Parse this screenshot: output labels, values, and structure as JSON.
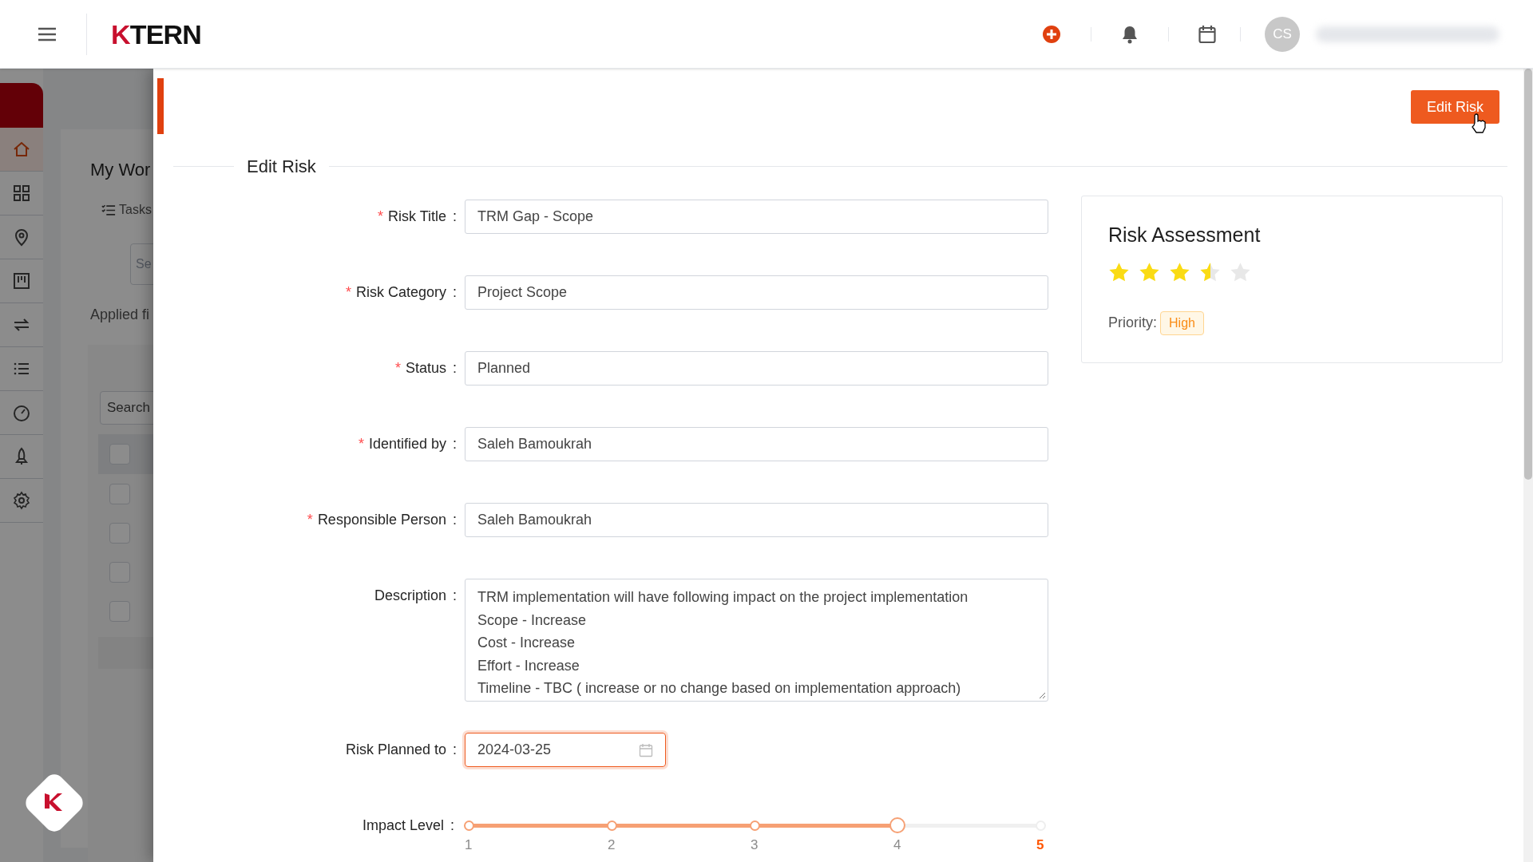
{
  "header": {
    "logo": "KTERN",
    "avatar_initials": "CS"
  },
  "sidebar": {
    "items": [
      {
        "selected": true
      },
      {
        "selected": false
      },
      {
        "selected": false
      },
      {
        "selected": false
      },
      {
        "selected": false
      },
      {
        "selected": false
      },
      {
        "selected": false
      },
      {
        "selected": false
      },
      {
        "selected": false
      }
    ]
  },
  "background_page": {
    "title": "My Wor",
    "tab": "Tasks",
    "search_placeholder": "Se",
    "applied_filters": "Applied fi",
    "table_search_placeholder": "Search",
    "rows": [
      {
        "kind": "header",
        "checked": false
      },
      {
        "kind": "row",
        "checked": false
      },
      {
        "kind": "row",
        "checked": false
      },
      {
        "kind": "row",
        "checked": false
      },
      {
        "kind": "row",
        "checked": false
      }
    ]
  },
  "drawer": {
    "action_button": "Edit Risk",
    "section_title": "Edit Risk",
    "fields": [
      {
        "kind": "input",
        "required_mark": "*",
        "label": "Risk Title",
        "separator": ":",
        "value": "TRM Gap - Scope"
      },
      {
        "kind": "input",
        "required_mark": "*",
        "label": "Risk Category",
        "separator": ":",
        "value": "Project Scope"
      },
      {
        "kind": "input",
        "required_mark": "*",
        "label": "Status",
        "separator": ":",
        "value": "Planned"
      },
      {
        "kind": "input",
        "required_mark": "*",
        "label": "Identified by",
        "separator": ":",
        "value": "Saleh Bamoukrah"
      },
      {
        "kind": "input",
        "required_mark": "*",
        "label": "Responsible Person",
        "separator": ":",
        "value": "Saleh Bamoukrah"
      },
      {
        "kind": "textarea",
        "label": "Description",
        "separator": ":",
        "lines": [
          "TRM implementation will have following impact on the project implementation",
          "Scope - Increase",
          "Cost - Increase",
          "Effort - Increase",
          "Timeline - TBC ( increase or no change based on implementation approach)"
        ]
      },
      {
        "kind": "date",
        "label": "Risk Planned to",
        "separator": ":",
        "value": "2024-03-25",
        "focused": true
      },
      {
        "kind": "slider",
        "label": "Impact Level",
        "separator": ":",
        "level": 0.75,
        "marks": [
          {
            "label": "1",
            "highlighted": false
          },
          {
            "label": "2",
            "highlighted": false
          },
          {
            "label": "3",
            "highlighted": false
          },
          {
            "label": "4",
            "highlighted": false
          },
          {
            "label": "5",
            "highlighted": true
          }
        ]
      }
    ],
    "assessment": {
      "title": "Risk Assessment",
      "stars": 3.5,
      "priority_label": "Priority:",
      "priority": "High"
    }
  }
}
